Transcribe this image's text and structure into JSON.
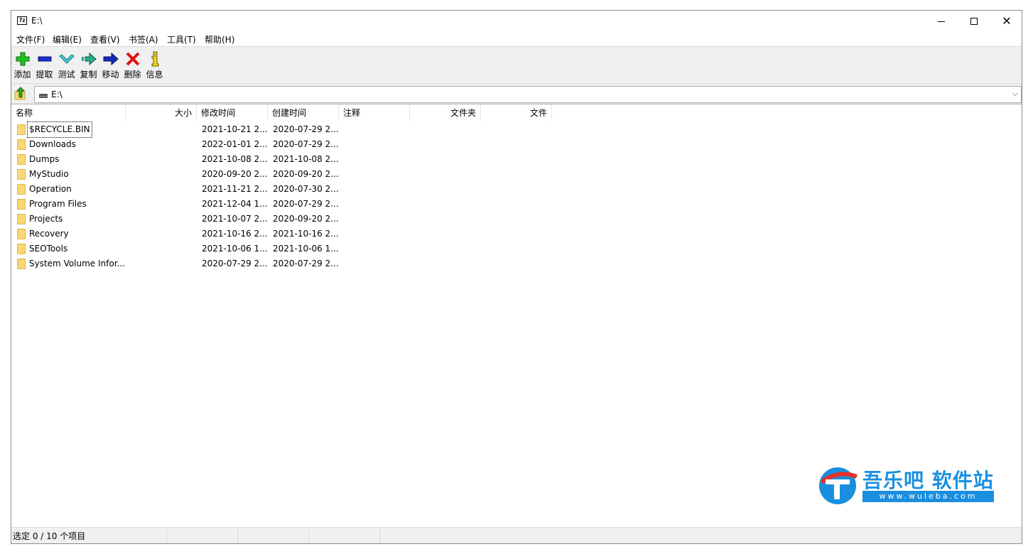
{
  "window": {
    "title": "E:\\",
    "app_icon_text": "7z"
  },
  "menu": [
    "文件(F)",
    "编辑(E)",
    "查看(V)",
    "书签(A)",
    "工具(T)",
    "帮助(H)"
  ],
  "toolbar": {
    "add": "添加",
    "extract": "提取",
    "test": "测试",
    "copy": "复制",
    "move": "移动",
    "delete": "删除",
    "info": "信息"
  },
  "address": {
    "path": "E:\\"
  },
  "columns": {
    "name": "名称",
    "size": "大小",
    "modified": "修改时间",
    "created": "创建时间",
    "comment": "注释",
    "folders": "文件夹",
    "files": "文件"
  },
  "rows": [
    {
      "name": "$RECYCLE.BIN",
      "modified": "2021-10-21 2...",
      "created": "2020-07-29 2..."
    },
    {
      "name": "Downloads",
      "modified": "2022-01-01 2...",
      "created": "2020-07-29 2..."
    },
    {
      "name": "Dumps",
      "modified": "2021-10-08 2...",
      "created": "2021-10-08 2..."
    },
    {
      "name": "MyStudio",
      "modified": "2020-09-20 2...",
      "created": "2020-09-20 2..."
    },
    {
      "name": "Operation",
      "modified": "2021-11-21 2...",
      "created": "2020-07-30 2..."
    },
    {
      "name": "Program Files",
      "modified": "2021-12-04 1...",
      "created": "2020-07-29 2..."
    },
    {
      "name": "Projects",
      "modified": "2021-10-07 2...",
      "created": "2020-09-20 2..."
    },
    {
      "name": "Recovery",
      "modified": "2021-10-16 2...",
      "created": "2021-10-16 2..."
    },
    {
      "name": "SEOTools",
      "modified": "2021-10-06 1...",
      "created": "2021-10-06 1..."
    },
    {
      "name": "System Volume Infor...",
      "modified": "2020-07-29 2...",
      "created": "2020-07-29 2..."
    }
  ],
  "status": {
    "selection": "选定 0 / 10 个项目"
  },
  "watermark": {
    "title": "吾乐吧 软件站",
    "url": "www.wuleba.com"
  },
  "colors": {
    "accent": "#1a8fe0",
    "folder": "#f8d775"
  }
}
